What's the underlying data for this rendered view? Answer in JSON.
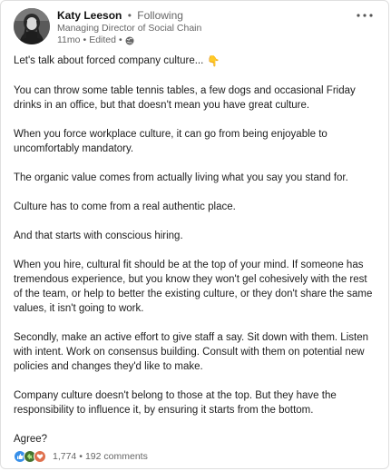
{
  "post": {
    "author": {
      "name": "Katy Leeson",
      "follow_status": "Following",
      "headline": "Managing Director of Social Chain"
    },
    "timestamp": "11mo",
    "edited": "Edited",
    "visibility_icon": "globe-icon",
    "more_icon": "more-horizontal-icon",
    "paragraphs": [
      "Let's talk about forced company culture...",
      "You can throw some table tennis tables, a few dogs and occasional Friday drinks in an office, but that doesn't mean you have great culture.",
      "When you force workplace culture, it can go from being enjoyable to uncomfortably mandatory.",
      "The organic value comes from actually living what you say you stand for.",
      "Culture has to come from a real authentic place.",
      "And that starts with conscious hiring.",
      "When you hire, cultural fit should be at the top of your mind. If someone has tremendous experience, but you know they won't gel cohesively with the rest of the team, or help to better the existing culture, or they don't share the same values, it isn't going to work.",
      "Secondly, make an active effort to give staff a say. Sit down with them. Listen with intent. Work on consensus building. Consult with them on potential new policies and changes they'd like to make.",
      "Company culture doesn't belong to those at the top. But they have the responsibility to influence it, by ensuring it starts from the bottom.",
      "Agree?"
    ],
    "opening_emoji": "👇",
    "social": {
      "reaction_icons": [
        "like-icon",
        "celebrate-icon",
        "love-icon"
      ],
      "reaction_count": "1,774",
      "separator": "•",
      "comments": "192 comments"
    },
    "colors": {
      "like": "#378fe9",
      "celebrate": "#44712e",
      "love": "#df704d",
      "meta_text": "#666666"
    }
  }
}
